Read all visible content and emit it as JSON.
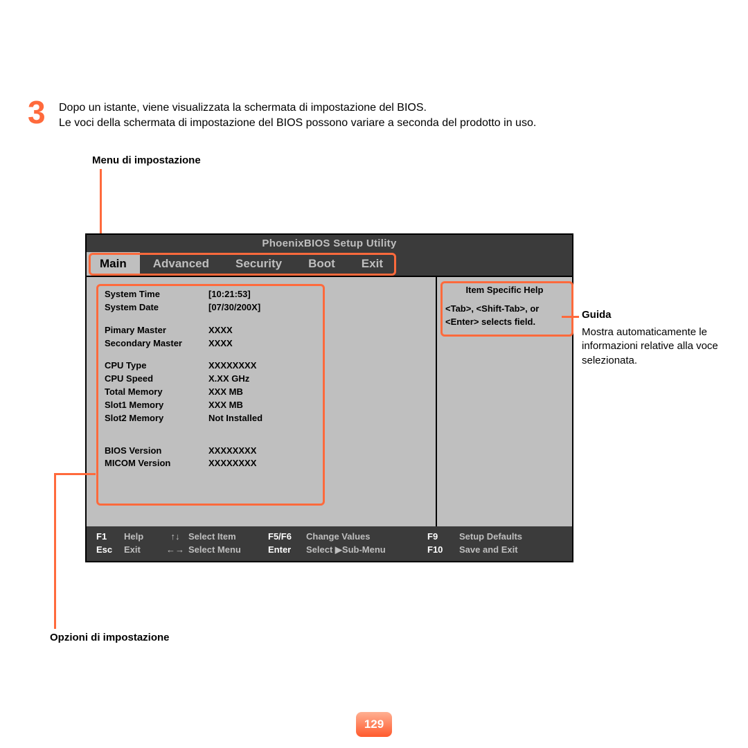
{
  "step": {
    "num": "3",
    "line1": "Dopo un istante, viene visualizzata la schermata di impostazione del BIOS.",
    "line2": "Le voci della schermata di impostazione del BIOS possono variare a seconda del prodotto in uso."
  },
  "labels": {
    "menu": "Menu di impostazione",
    "options": "Opzioni di impostazione",
    "guide": "Guida",
    "guide_text": "Mostra automaticamente le informazioni relative alla voce selezionata."
  },
  "bios": {
    "title": "PhoenixBIOS Setup Utility",
    "tabs": [
      "Main",
      "Advanced",
      "Security",
      "Boot",
      "Exit"
    ],
    "rows": [
      {
        "k": "System Time",
        "v": "[10:21:53]"
      },
      {
        "k": "System Date",
        "v": "[07/30/200X]"
      },
      {
        "gap": true
      },
      {
        "k": "Pimary Master",
        "v": "XXXX"
      },
      {
        "k": "Secondary Master",
        "v": "XXXX"
      },
      {
        "gap": true
      },
      {
        "k": "CPU Type",
        "v": "XXXXXXXX"
      },
      {
        "k": "CPU Speed",
        "v": "X.XX GHz"
      },
      {
        "k": "Total Memory",
        "v": "XXX MB"
      },
      {
        "k": "Slot1 Memory",
        "v": "XXX MB"
      },
      {
        "k": "Slot2 Memory",
        "v": "Not Installed"
      },
      {
        "gap": true
      },
      {
        "gap": true
      },
      {
        "k": "BIOS Version",
        "v": "XXXXXXXX"
      },
      {
        "k": "MICOM Version",
        "v": "XXXXXXXX"
      }
    ],
    "help": {
      "title": "Item Specific Help",
      "text1": "<Tab>, <Shift-Tab>, or",
      "text2": "<Enter> selects field."
    },
    "footer": {
      "line1": {
        "k1": "F1",
        "a1": "Help",
        "arr": "↑↓",
        "d1": "Select Item",
        "k2": "F5/F6",
        "d2": "Change Values",
        "k3": "F9",
        "d3": "Setup Defaults"
      },
      "line2": {
        "k1": "Esc",
        "a1": "Exit",
        "arr": "←→",
        "d1": "Select Menu",
        "k2": "Enter",
        "d2": "Select ▶Sub-Menu",
        "k3": "F10",
        "d3": "Save and Exit"
      }
    }
  },
  "page": "129"
}
